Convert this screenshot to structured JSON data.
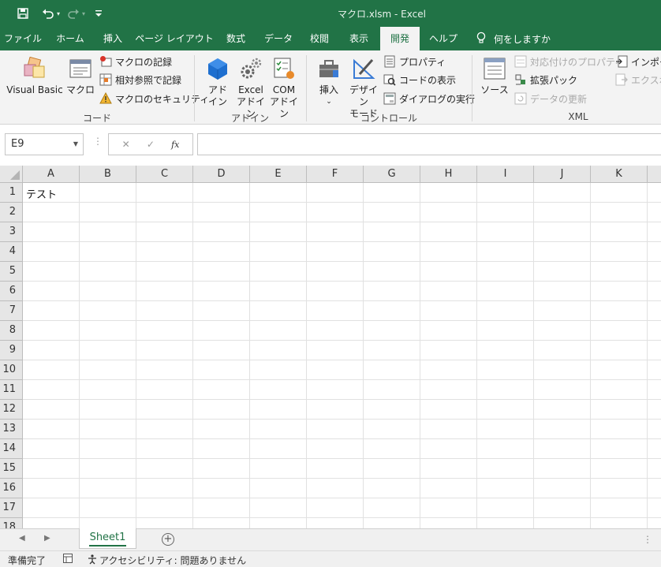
{
  "window": {
    "title": "マクロ.xlsm  -  Excel"
  },
  "tabs": [
    {
      "label": "ファイル"
    },
    {
      "label": "ホーム"
    },
    {
      "label": "挿入"
    },
    {
      "label": "ページ レイアウト"
    },
    {
      "label": "数式"
    },
    {
      "label": "データ"
    },
    {
      "label": "校閲"
    },
    {
      "label": "表示"
    },
    {
      "label": "開発"
    },
    {
      "label": "ヘルプ"
    }
  ],
  "tell_me": "何をしますか",
  "ribbon": {
    "code": {
      "label": "コード",
      "visual_basic": "Visual Basic",
      "macro": "マクロ",
      "record_macro": "マクロの記録",
      "relative_ref": "相対参照で記録",
      "macro_security": "マクロのセキュリティ"
    },
    "addins": {
      "label": "アドイン",
      "addin_1": "アド",
      "addin_2": "イン",
      "excel_addin_1": "Excel",
      "excel_addin_2": "アドイン",
      "com_addin_1": "COM",
      "com_addin_2": "アドイン"
    },
    "controls": {
      "label": "コントロール",
      "insert": "挿入",
      "design_mode_1": "デザイン",
      "design_mode_2": "モード",
      "properties": "プロパティ",
      "view_code": "コードの表示",
      "run_dialog": "ダイアログの実行"
    },
    "xml": {
      "label": "XML",
      "source": "ソース",
      "map_properties": "対応付けのプロパティ",
      "expansion_packs": "拡張パック",
      "refresh_data": "データの更新",
      "import": "インポート",
      "export": "エクスポート"
    }
  },
  "formula_bar": {
    "name_box": "E9",
    "fx": "fx",
    "formula": ""
  },
  "sheet": {
    "columns": [
      "A",
      "B",
      "C",
      "D",
      "E",
      "F",
      "G",
      "H",
      "I",
      "J",
      "K"
    ],
    "rows": [
      "1",
      "2",
      "3",
      "4",
      "5",
      "6",
      "7",
      "8",
      "9",
      "10",
      "11",
      "12",
      "13",
      "14",
      "15",
      "16",
      "17",
      "18"
    ],
    "cells": {
      "A1": "テスト"
    }
  },
  "sheet_tabs": [
    {
      "label": "Sheet1",
      "active": true
    }
  ],
  "status_bar": {
    "ready": "準備完了",
    "accessibility": "アクセシビリティ: 問題ありません"
  },
  "colors": {
    "brand": "#217346",
    "ribbon_bg": "#f3f3f3",
    "header_bg": "#e6e6e6"
  }
}
